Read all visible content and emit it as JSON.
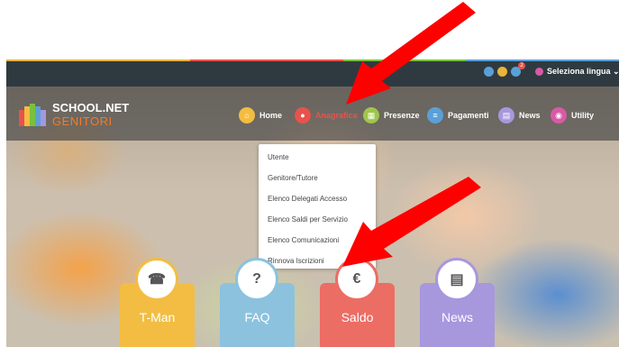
{
  "topbar": {
    "badge_count": "2",
    "language_label": "Seleziona lingua ⌄",
    "icons": [
      "power-icon",
      "help-icon",
      "bell-icon",
      "globe-icon"
    ]
  },
  "logo": {
    "line1": "SCHOOL.NET",
    "line2": "GENITORI"
  },
  "nav": {
    "home": "Home",
    "anagrafica": "Anagrafica",
    "presenze": "Presenze",
    "pagamenti": "Pagamenti",
    "news": "News",
    "utility": "Utility"
  },
  "dropdown": {
    "items": [
      "Utente",
      "Genitore/Tutore",
      "Elenco Delegati Accesso",
      "Elenco Saldi per Servizio",
      "Elenco Comunicazioni",
      "Rinnova Iscrizioni"
    ]
  },
  "cards": [
    {
      "label": "T-Man",
      "icon_text": "☎",
      "color": "#f2bd42"
    },
    {
      "label": "FAQ",
      "icon_text": "?",
      "color": "#8cc2dd"
    },
    {
      "label": "Saldo",
      "icon_text": "€",
      "color": "#ec6d64"
    },
    {
      "label": "News",
      "icon_text": "▤",
      "color": "#a797dd"
    }
  ],
  "colors": {
    "topbar": "#2f3a40",
    "active_nav": "#e8524c",
    "annotation_arrow": "#ff0000"
  }
}
